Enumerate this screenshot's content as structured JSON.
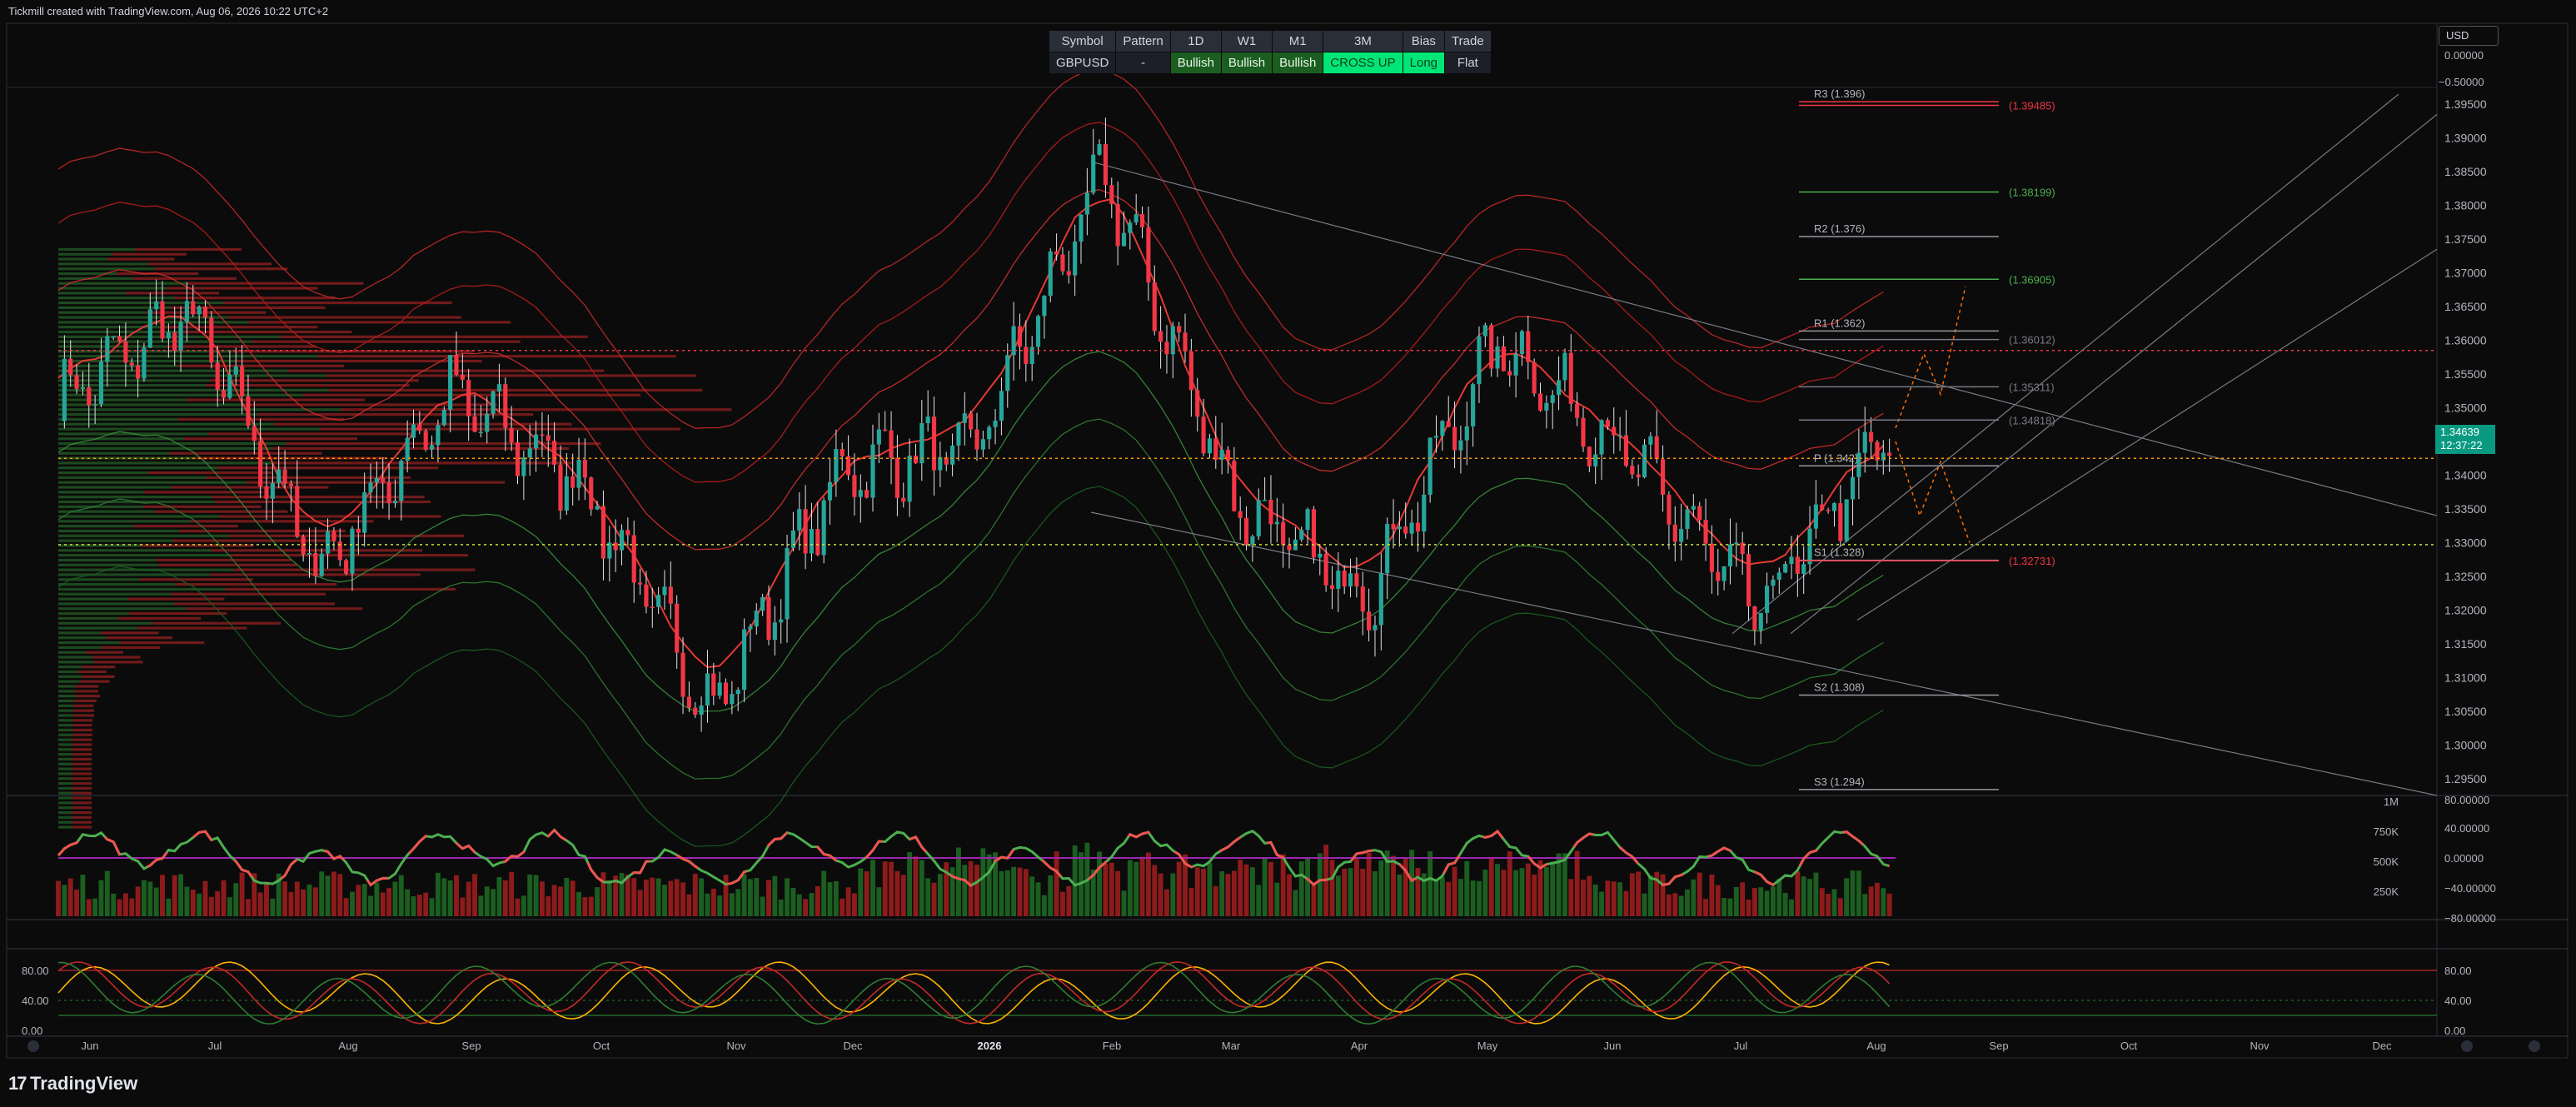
{
  "header": {
    "text": "Tickmill created with TradingView.com, Aug 06, 2026 10:22 UTC+2"
  },
  "currency_selector": "USD",
  "status_table": {
    "headers": [
      "Symbol",
      "Pattern",
      "1D",
      "W1",
      "M1",
      "3M",
      "Bias",
      "Trade"
    ],
    "row": [
      "GBPUSD",
      "-",
      "Bullish",
      "Bullish",
      "Bullish",
      "CROSS UP",
      "Long",
      "Flat"
    ]
  },
  "current_price": {
    "value": "1.34639",
    "countdown": "12:37:22"
  },
  "footer": {
    "brand": "TradingView"
  },
  "colors": {
    "up": "#089981",
    "down": "#f23645",
    "bg": "#0b0b0b"
  },
  "chart_data": [
    {
      "type": "candlestick",
      "symbol": "GBPUSD",
      "x_ticks": [
        "Jun",
        "Jul",
        "Aug",
        "Sep",
        "Oct",
        "Nov",
        "Dec",
        "2026",
        "Feb",
        "Mar",
        "Apr",
        "May",
        "Jun",
        "Jul",
        "Aug",
        "Sep",
        "Oct",
        "Nov",
        "Dec"
      ],
      "y_ticks": [
        "1.39500",
        "1.39000",
        "1.38500",
        "1.38000",
        "1.37500",
        "1.37000",
        "1.36500",
        "1.36000",
        "1.35500",
        "1.35000",
        "1.34500",
        "1.34000",
        "1.33500",
        "1.33000",
        "1.32500",
        "1.32000",
        "1.31500",
        "1.31000",
        "1.30500",
        "1.30000",
        "1.29500"
      ],
      "ylim": [
        1.2925,
        1.3975
      ],
      "top_axis_labels": [
        "0.00000",
        "−0.50000"
      ],
      "approx_close_path": [
        {
          "m": "Jun",
          "v": 1.351
        },
        {
          "m": "Jul",
          "v": 1.364
        },
        {
          "m": "Aug",
          "v": 1.326
        },
        {
          "m": "Sep",
          "v": 1.352
        },
        {
          "m": "Oct",
          "v": 1.339
        },
        {
          "m": "Nov",
          "v": 1.305
        },
        {
          "m": "Dec",
          "v": 1.341
        },
        {
          "m": "2026",
          "v": 1.344
        },
        {
          "m": "Feb",
          "v": 1.385
        },
        {
          "m": "Mar",
          "v": 1.336
        },
        {
          "m": "Apr",
          "v": 1.322
        },
        {
          "m": "May",
          "v": 1.36
        },
        {
          "m": "Jun",
          "v": 1.343
        },
        {
          "m": "Jul",
          "v": 1.32
        },
        {
          "m": "Aug",
          "v": 1.346
        }
      ],
      "pivot_levels": [
        {
          "label": "R3 (1.396)",
          "value": 1.396,
          "color": "#f23645"
        },
        {
          "label": "R2 (1.376)",
          "value": 1.376,
          "color": "#9598a1"
        },
        {
          "label": "R1 (1.362)",
          "value": 1.362,
          "color": "#9598a1"
        },
        {
          "label": "P (1.342)",
          "value": 1.342,
          "color": "#9598a1"
        },
        {
          "label": "S1 (1.328)",
          "value": 1.328,
          "color": "#9598a1"
        },
        {
          "label": "S2 (1.308)",
          "value": 1.308,
          "color": "#9598a1"
        },
        {
          "label": "S3 (1.294)",
          "value": 1.294,
          "color": "#9598a1"
        }
      ],
      "price_labels": [
        {
          "text": "(1.39485)",
          "value": 1.39485,
          "color": "#f23645"
        },
        {
          "text": "(1.38199)",
          "value": 1.38199,
          "color": "#4caf50"
        },
        {
          "text": "(1.36905)",
          "value": 1.36905,
          "color": "#4caf50"
        },
        {
          "text": "(1.36012)",
          "value": 1.36012,
          "color": "#787b86"
        },
        {
          "text": "(1.35311)",
          "value": 1.35311,
          "color": "#787b86"
        },
        {
          "text": "(1.34818)",
          "value": 1.34818,
          "color": "#787b86"
        },
        {
          "text": "(1.32731)",
          "value": 1.32731,
          "color": "#f23645"
        }
      ],
      "horizontal_dotted": [
        {
          "value": 1.3585,
          "color": "#f23645"
        },
        {
          "value": 1.3425,
          "color": "#ff9800"
        },
        {
          "value": 1.3297,
          "color": "#cddc39"
        }
      ]
    },
    {
      "type": "bar+line",
      "name": "volume",
      "y_ticks_right": [
        "1M",
        "750K",
        "500K",
        "250K"
      ],
      "y_ticks_osc": [
        "80.00000",
        "40.00000",
        "0.00000",
        "−40.00000",
        "−80.00000"
      ]
    },
    {
      "type": "line",
      "name": "stochastic",
      "y_ticks_left": [
        "80.00",
        "40.00",
        "0.00"
      ],
      "y_ticks_right": [
        "80.00",
        "40.00",
        "0.00"
      ]
    }
  ]
}
